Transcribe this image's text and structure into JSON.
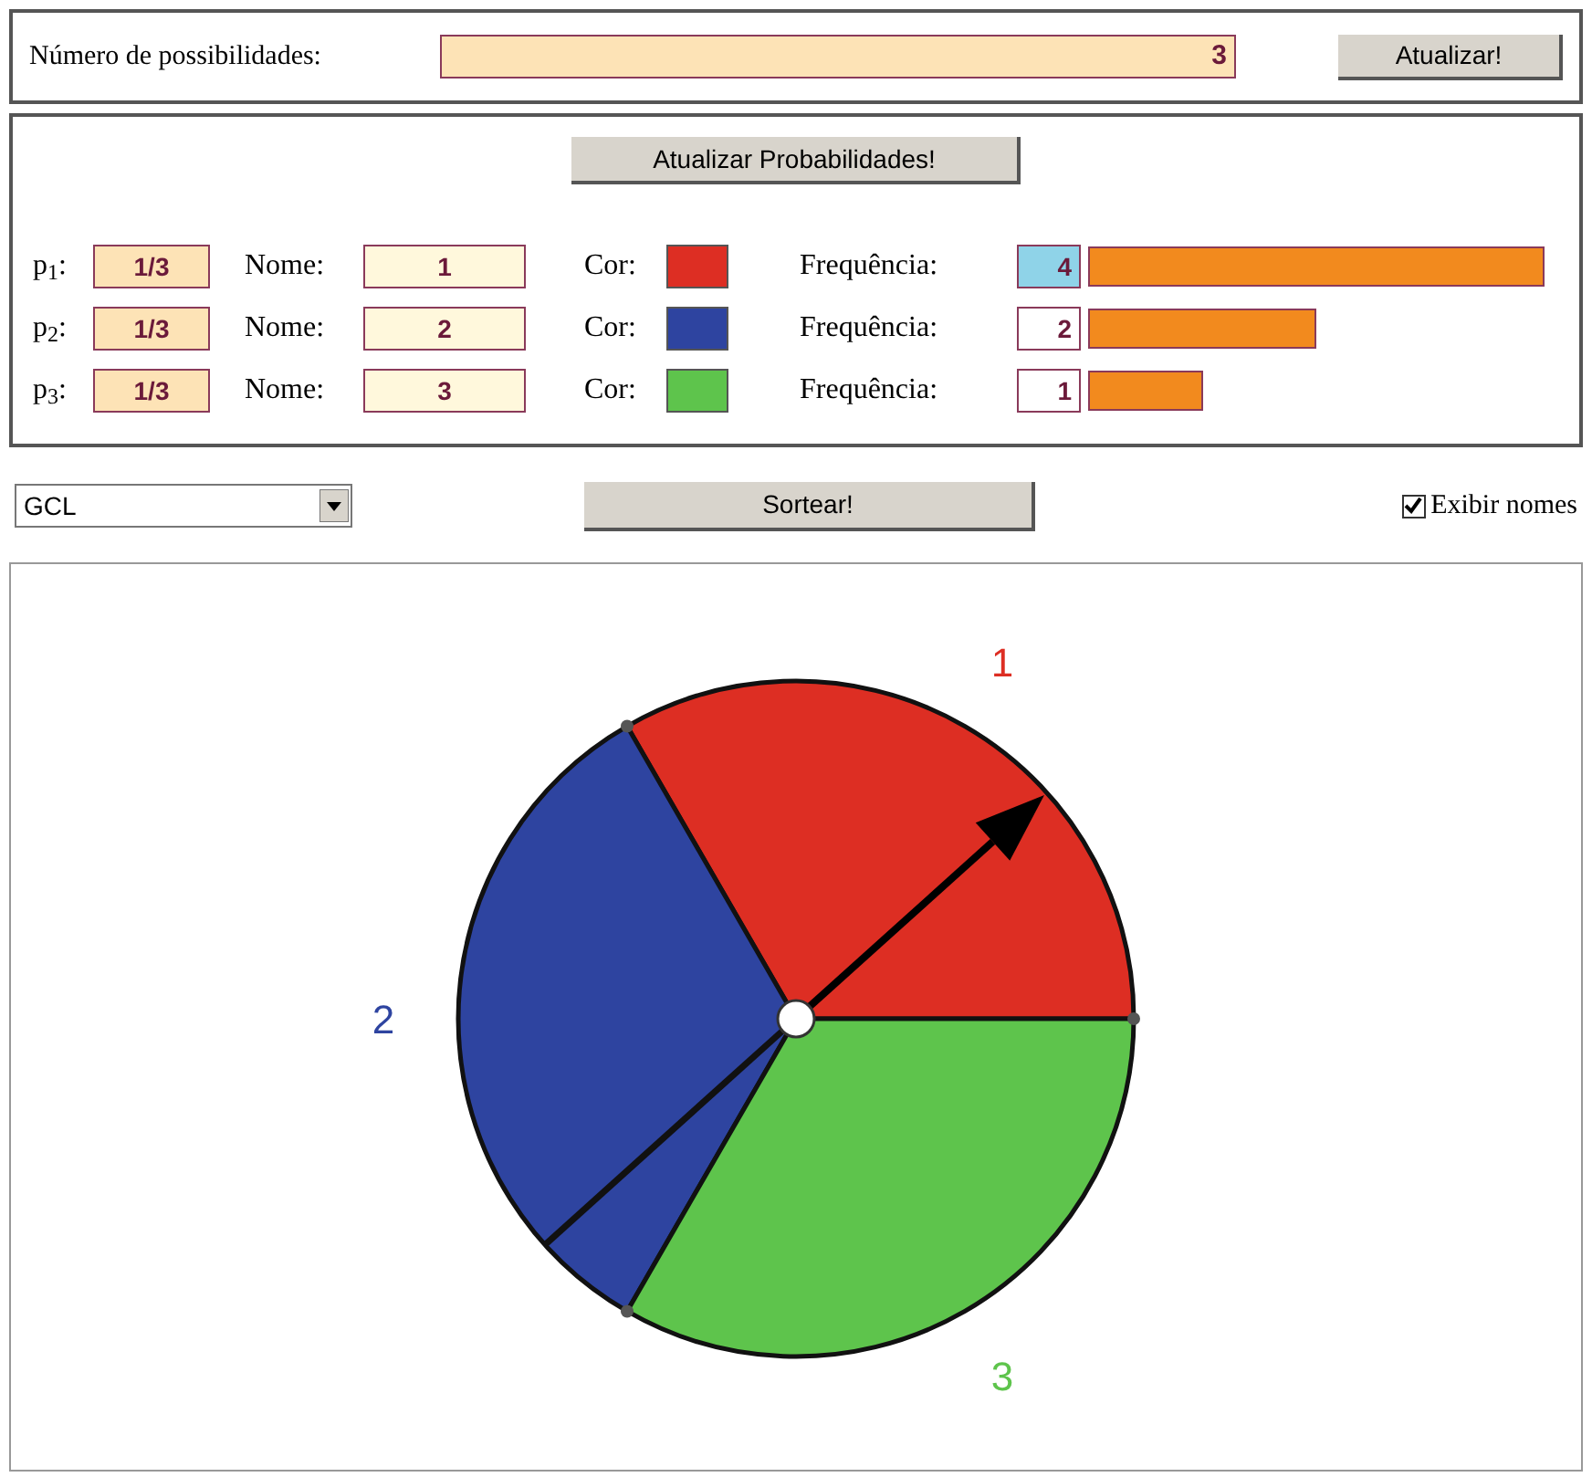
{
  "possibilities": {
    "label": "Número de possibilidades:",
    "value": "3",
    "button": "Atualizar!"
  },
  "probabilities": {
    "button": "Atualizar Probabilidades!",
    "rows": [
      {
        "p_label": "p$_{1}$:",
        "probability": "1/3",
        "name_label": "Nome:",
        "name": "1",
        "color_label": "Cor:",
        "color": "#dd2e23",
        "frequency_label": "Frequência:",
        "frequency": "4",
        "selected": true
      },
      {
        "p_label": "p$_{2}$:",
        "probability": "1/3",
        "name_label": "Nome:",
        "name": "2",
        "color_label": "Cor:",
        "color": "#2e44a0",
        "frequency_label": "Frequência:",
        "frequency": "2",
        "selected": false
      },
      {
        "p_label": "p$_{3}$:",
        "probability": "1/3",
        "name_label": "Nome:",
        "name": "3",
        "color_label": "Cor:",
        "color": "#5ec44c",
        "frequency_label": "Frequência:",
        "frequency": "1",
        "selected": false
      }
    ]
  },
  "controls": {
    "method": "GCL",
    "draw_button": "Sortear!",
    "show_names": {
      "label": "Exibir nomes",
      "checked": true
    }
  },
  "spinner": {
    "labels": [
      "1",
      "2",
      "3"
    ]
  }
}
